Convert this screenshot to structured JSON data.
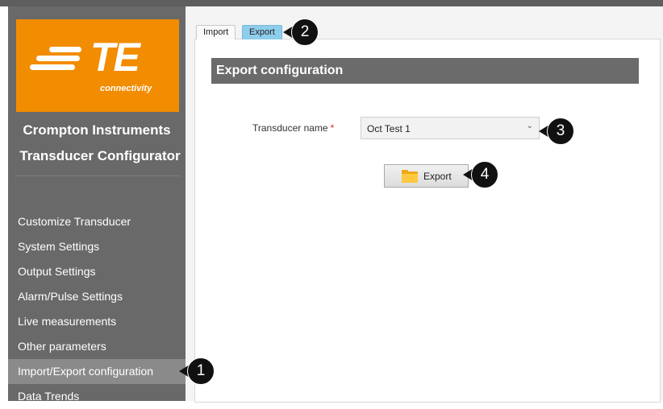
{
  "brand": {
    "logo_text": "TE",
    "logo_subtext": "connectivity",
    "orange": "#f28c00"
  },
  "app": {
    "title_line1": "Crompton Instruments",
    "title_line2": "Transducer Configurator"
  },
  "sidebar": {
    "items": [
      {
        "label": "Customize Transducer"
      },
      {
        "label": "System Settings"
      },
      {
        "label": "Output Settings"
      },
      {
        "label": "Alarm/Pulse Settings"
      },
      {
        "label": "Live measurements"
      },
      {
        "label": "Other parameters"
      },
      {
        "label": "Import/Export configuration",
        "active": true
      },
      {
        "label": "Data Trends"
      }
    ]
  },
  "tabs": [
    {
      "label": "Import"
    },
    {
      "label": "Export",
      "selected": true
    }
  ],
  "section": {
    "title": "Export configuration"
  },
  "form": {
    "transducer_label": "Transducer name",
    "required_marker": "*",
    "transducer_value": "Oct Test 1",
    "export_button": "Export"
  },
  "callouts": {
    "c1": "1",
    "c2": "2",
    "c3": "3",
    "c4": "4"
  },
  "colors": {
    "sidebar": "#696969",
    "active_tab": "#8fcdec",
    "header": "#6b6b6b"
  }
}
